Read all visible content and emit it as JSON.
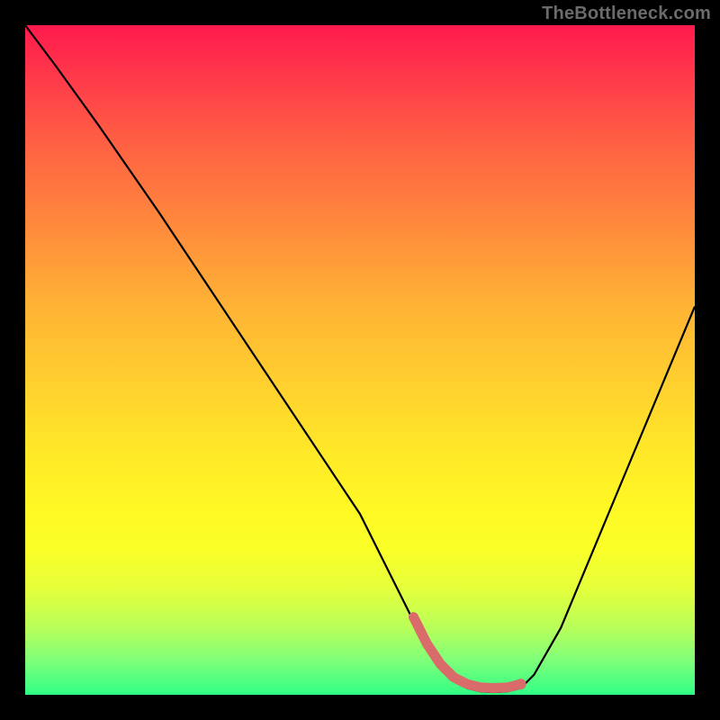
{
  "watermark": "TheBottleneck.com",
  "colors": {
    "background": "#000000",
    "gradient_top": "#ff1a4d",
    "gradient_bottom": "#30ff85",
    "curve": "#000000",
    "marker": "#d96b6b"
  },
  "chart_data": {
    "type": "line",
    "title": "",
    "xlabel": "",
    "ylabel": "",
    "xlim": [
      0,
      100
    ],
    "ylim": [
      0,
      100
    ],
    "series": [
      {
        "name": "curve",
        "x": [
          0,
          4.5,
          11,
          20,
          30,
          40,
          50,
          56,
          58,
          60,
          62,
          64,
          66,
          68,
          70,
          72,
          74,
          76,
          80,
          85,
          90,
          95,
          100
        ],
        "y": [
          100,
          94,
          85,
          72,
          57,
          42,
          27,
          15,
          11,
          7,
          4,
          2,
          1,
          0.5,
          0.4,
          0.5,
          1,
          3,
          10,
          22,
          34,
          46,
          58
        ]
      }
    ],
    "markers": [
      {
        "name": "valley-highlight",
        "x_start": 58,
        "x_end": 74,
        "y": 0.3,
        "color": "#d96b6b"
      }
    ]
  }
}
